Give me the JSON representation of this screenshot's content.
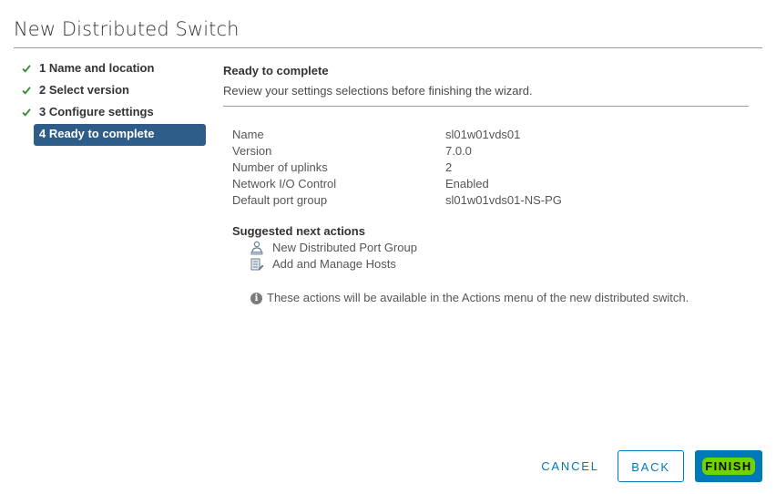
{
  "dialog": {
    "title": "New Distributed Switch"
  },
  "steps": [
    {
      "label": "1 Name and location",
      "completed": true
    },
    {
      "label": "2 Select version",
      "completed": true
    },
    {
      "label": "3 Configure settings",
      "completed": true
    },
    {
      "label": "4 Ready to complete",
      "active": true
    }
  ],
  "main": {
    "section_title": "Ready to complete",
    "section_desc": "Review your settings selections before finishing the wizard.",
    "summary": [
      {
        "key": "Name",
        "value": "sl01w01vds01"
      },
      {
        "key": "Version",
        "value": "7.0.0"
      },
      {
        "key": "Number of uplinks",
        "value": "2"
      },
      {
        "key": "Network I/O Control",
        "value": "Enabled"
      },
      {
        "key": "Default port group",
        "value": "sl01w01vds01-NS-PG"
      }
    ],
    "next_actions_title": "Suggested next actions",
    "next_actions": [
      {
        "label": "New Distributed Port Group",
        "icon": "port-group-icon"
      },
      {
        "label": "Add and Manage Hosts",
        "icon": "manage-hosts-icon"
      }
    ],
    "info_note": "These actions will be available in the Actions menu of the new distributed switch."
  },
  "footer": {
    "cancel_label": "CANCEL",
    "back_label": "BACK",
    "finish_label": "FINISH"
  },
  "colors": {
    "accent": "#0079b8",
    "active_step_bg": "#2f5d8a",
    "check_green": "#2e8b2e",
    "finish_highlight": "#6fd400"
  }
}
